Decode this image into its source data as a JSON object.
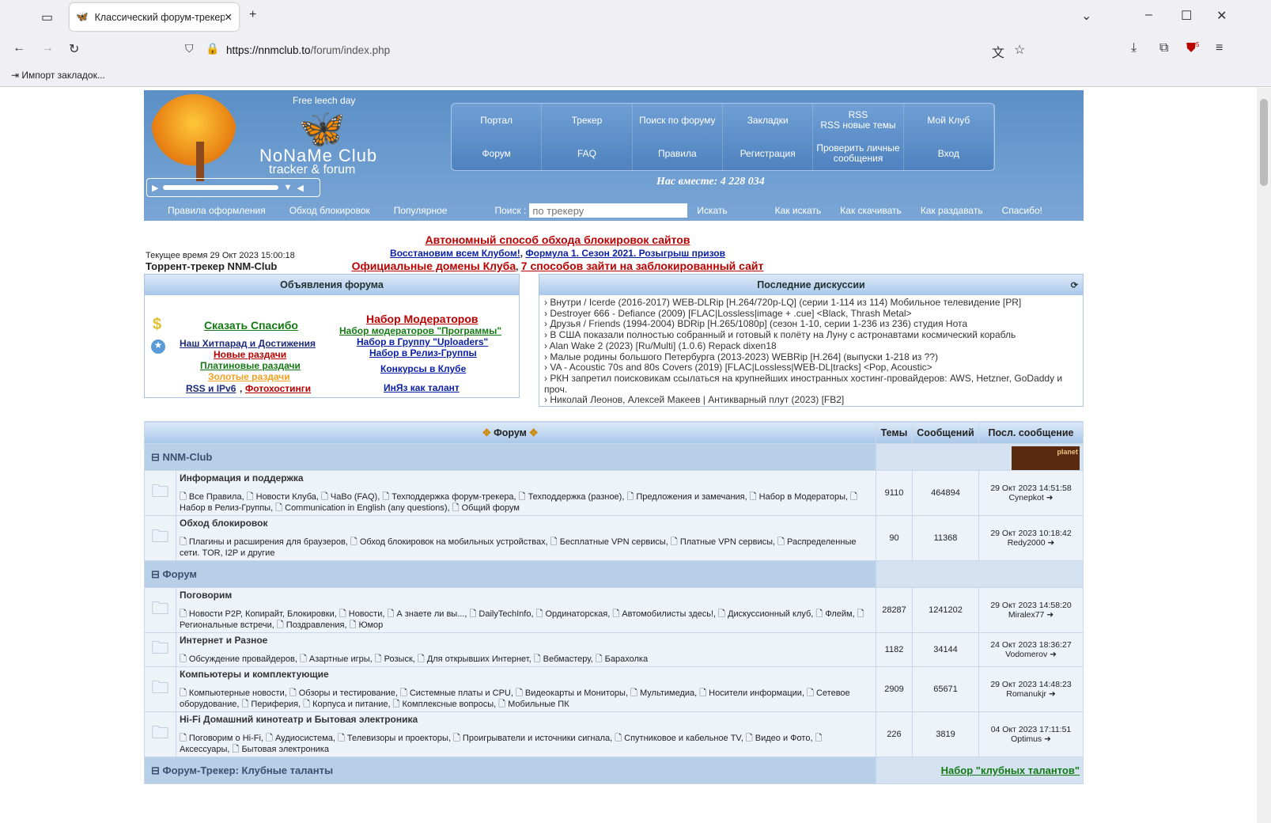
{
  "browser": {
    "tab_title": "Классический форум-трекер",
    "url_host": "https://nnmclub.to",
    "url_path": "/forum/index.php",
    "bookmark": "Импорт закладок...",
    "ext_badge": "5"
  },
  "header": {
    "free_leech": "Free leech day",
    "brand": "NoNaMe Club",
    "brand_sub": "tracker & forum",
    "menu": [
      "Портал",
      "Трекер",
      "Поиск по форуму",
      "Закладки",
      "RSS\nRSS новые темы",
      "Мой Клуб",
      "Форум",
      "FAQ",
      "Правила",
      "Регистрация",
      "Проверить личные сообщения",
      "Вход"
    ],
    "together": "Нас вместе: 4 228 034",
    "subnav_left": [
      "Правила оформления",
      "Обход блокировок",
      "Популярное"
    ],
    "search_label": "Поиск :",
    "search_placeholder": "по трекеру",
    "search_button": "Искать",
    "subnav_right": [
      "Как искать",
      "Как скачивать",
      "Как раздавать",
      "Спасибо!"
    ]
  },
  "info": {
    "time": "Текущее время 29 Окт 2023 15:00:18",
    "title": "Торрент-трекер NNM-Club"
  },
  "announce": {
    "line1": "Автономный способ обхода блокировок сайтов",
    "line2a": "Восстановим всем Клубом!",
    "line2b": "Формула 1. Сезон 2021. Розыгрыш призов",
    "line3a": "Официальные домены Клуба",
    "line3b": "7 способов зайти на заблокированный сайт"
  },
  "ads": {
    "title": "Объявления форума",
    "left": [
      "Сказать Спасибо",
      "Наш Хитпарад и Достижения",
      "Новые раздачи",
      "Платиновые раздачи",
      "Золотые раздачи",
      "RSS и IPv6",
      "Фотохостинги"
    ],
    "right": [
      "Набор Модераторов",
      "Набор модераторов \"Программы\"",
      "Набор в Группу \"Uploaders\"",
      "Набор в Релиз-Группы",
      "Конкурсы в Клубе",
      "ИнЯз как талант"
    ]
  },
  "discussions": {
    "title": "Последние дискуссии",
    "items": [
      "Внутри / Icerde (2016-2017) WEB-DLRip [H.264/720p-LQ] (серии 1-114 из 114) Мобильное телевидение [PR]",
      "Destroyer 666 - Defiance (2009) [FLAC|Lossless|image + .cue] <Black, Thrash Metal>",
      "Друзья / Friends (1994-2004) BDRip [H.265/1080p] (сезон 1-10, серии 1-236 из 236) студия Нота",
      "В США показали полностью собранный и готовый к полёту на Луну с астронавтами космический корабль",
      "Alan Wake 2 (2023) [Ru/Multi] (1.0.6) Repack dixen18",
      "Малые родины большого Петербурга (2013-2023) WEBRip [H.264] (выпуски 1-218 из ??)",
      "VA - Acoustic 70s and 80s Covers (2019) [FLAC|Lossless|WEB-DL|tracks] <Pop, Acoustic>",
      "РКН запретил поисковикам ссылаться на крупнейших иностранных хостинг-провайдеров: AWS, Hetzner, GoDaddy и проч.",
      "Николай Леонов, Алексей Макеев | Антикварный плут (2023) [FB2]"
    ]
  },
  "forum": {
    "headers": [
      "Форум",
      "Темы",
      "Сообщений",
      "Посл. сообщение"
    ],
    "categories": [
      {
        "name": "NNM-Club",
        "right": "planet",
        "forums": [
          {
            "name": "Информация и поддержка",
            "subs": [
              "Все Правила",
              "Новости Клуба",
              "ЧаВо (FAQ)",
              "Техподдержка форум-трекера",
              "Техподдержка (разное)",
              "Предложения и замечания",
              "Набор в Модераторы",
              "Набор в Релиз-Группы",
              "Communication in English (any questions)",
              "Общий форум"
            ],
            "topics": "9110",
            "posts": "464894",
            "last_date": "29 Окт 2023 14:51:58",
            "last_user": "Cynepkot"
          },
          {
            "name": "Обход блокировок",
            "subs": [
              "Плагины и расширения для браузеров",
              "Обход блокировок на мобильных устройствах",
              "Бесплатные VPN сервисы",
              "Платные VPN сервисы",
              "Распределенные сети. TOR, I2P и другие"
            ],
            "topics": "90",
            "posts": "11368",
            "last_date": "29 Окт 2023 10:18:42",
            "last_user": "Redy2000"
          }
        ]
      },
      {
        "name": "Форум",
        "right": "",
        "forums": [
          {
            "name": "Поговорим",
            "subs": [
              "Новости P2P, Копирайт, Блокировки",
              "Новости",
              "А знаете ли вы...",
              "DailyTechInfo",
              "Ординаторская",
              "Автомобилисты здесь!",
              "Дискуссионный клуб",
              "Флейм",
              "Региональные встречи",
              "Поздравления",
              "Юмор"
            ],
            "topics": "28287",
            "posts": "1241202",
            "last_date": "29 Окт 2023 14:58:20",
            "last_user": "Miralex77"
          },
          {
            "name": "Интернет и Разное",
            "subs": [
              "Обсуждение провайдеров",
              "Азартные игры",
              "Розыск",
              "Для открывших Интернет",
              "Вебмастеру",
              "Барахолка"
            ],
            "topics": "1182",
            "posts": "34144",
            "last_date": "24 Окт 2023 18:36:27",
            "last_user": "Vodomerov"
          },
          {
            "name": "Компьютеры и комплектующие",
            "subs": [
              "Компьютерные новости",
              "Обзоры и тестирование",
              "Системные платы и CPU",
              "Видеокарты и Мониторы",
              "Мультимедиа",
              "Носители информации",
              "Сетевое оборудование",
              "Периферия",
              "Корпуса и питание",
              "Комплексные вопросы",
              "Мобильные ПК"
            ],
            "topics": "2909",
            "posts": "65671",
            "last_date": "29 Окт 2023 14:48:23",
            "last_user": "Romanukjr"
          },
          {
            "name": "Hi-Fi Домашний кинотеатр и Бытовая электроника",
            "subs": [
              "Поговорим о Hi-Fi",
              "Аудиосистема",
              "Телевизоры и проекторы",
              "Проигрыватели и источники сигнала",
              "Спутниковое и кабельное TV",
              "Видео и Фото",
              "Аксессуары",
              "Бытовая электроника"
            ],
            "topics": "226",
            "posts": "3819",
            "last_date": "04 Окт 2023 17:11:51",
            "last_user": "Optimus"
          }
        ]
      },
      {
        "name": "Форум-Трекер: Клубные таланты",
        "right": "Набор \"клубных талантов\"",
        "forums": []
      }
    ]
  }
}
